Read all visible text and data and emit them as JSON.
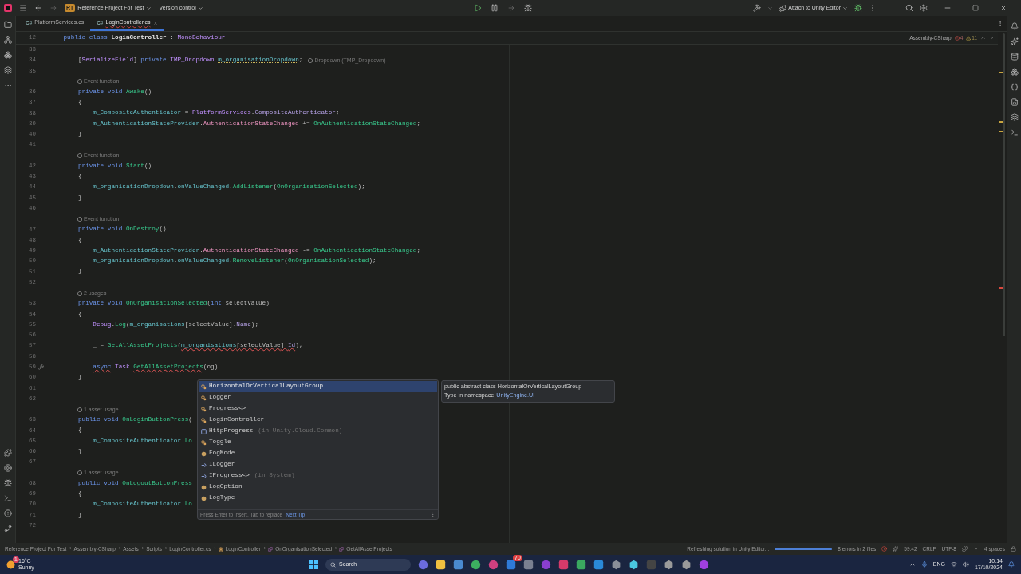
{
  "titlebar": {
    "project_badge": "RT",
    "project": "Reference Project For Test",
    "vcs": "Version control",
    "attach": "Attach to Unity Editor"
  },
  "tabs": [
    {
      "label": "PlatformServices.cs",
      "icon": "C#",
      "selected": false
    },
    {
      "label": "LoginController.cs",
      "icon": "C#",
      "selected": true
    }
  ],
  "editor": {
    "context": "Assembly-CSharp",
    "errors": "4",
    "warnings": "11",
    "sticky": {
      "n": "12",
      "tokens": [
        {
          "t": "    public class ",
          "kind": "kw"
        },
        {
          "t": "LoginController",
          "kind": "decl"
        },
        {
          "t": " : ",
          "kind": "plain"
        },
        {
          "t": "MonoBehaviour",
          "kind": "type"
        }
      ]
    },
    "rows": [
      {
        "kind": "code",
        "n": "33",
        "tokens": []
      },
      {
        "kind": "code",
        "n": "34",
        "tokens": [
          {
            "t": "        [",
            "kind": "plain"
          },
          {
            "t": "SerializeField",
            "kind": "type"
          },
          {
            "t": "] ",
            "kind": "plain"
          },
          {
            "t": "private ",
            "kind": "kw"
          },
          {
            "t": "TMP_Dropdown ",
            "kind": "type"
          },
          {
            "t": "m_organisationDropdown",
            "kind": "field_marked"
          },
          {
            "t": ";",
            "kind": "plain"
          }
        ],
        "inlay": "Dropdown (TMP_Dropdown)"
      },
      {
        "kind": "code",
        "n": "35",
        "tokens": []
      },
      {
        "kind": "hint",
        "text": "Event function"
      },
      {
        "kind": "code",
        "n": "36",
        "tokens": [
          {
            "t": "        private void ",
            "kind": "kw"
          },
          {
            "t": "Awake",
            "kind": "method"
          },
          {
            "t": "()",
            "kind": "plain"
          }
        ]
      },
      {
        "kind": "code",
        "n": "37",
        "tokens": [
          {
            "t": "        {",
            "kind": "plain"
          }
        ]
      },
      {
        "kind": "code",
        "n": "38",
        "tokens": [
          {
            "t": "            m_CompositeAuthenticator",
            "kind": "field"
          },
          {
            "t": " = ",
            "kind": "plain"
          },
          {
            "t": "PlatformServices",
            "kind": "type"
          },
          {
            "t": ".",
            "kind": "plain"
          },
          {
            "t": "CompositeAuthenticator",
            "kind": "prop"
          },
          {
            "t": ";",
            "kind": "plain"
          }
        ]
      },
      {
        "kind": "code",
        "n": "39",
        "tokens": [
          {
            "t": "            m_AuthenticationStateProvider",
            "kind": "field"
          },
          {
            "t": ".",
            "kind": "plain"
          },
          {
            "t": "AuthenticationStateChanged",
            "kind": "event"
          },
          {
            "t": " += ",
            "kind": "plain"
          },
          {
            "t": "OnAuthenticationStateChanged",
            "kind": "method"
          },
          {
            "t": ";",
            "kind": "plain"
          }
        ]
      },
      {
        "kind": "code",
        "n": "40",
        "tokens": [
          {
            "t": "        }",
            "kind": "plain"
          }
        ]
      },
      {
        "kind": "code",
        "n": "41",
        "tokens": []
      },
      {
        "kind": "hint",
        "text": "Event function"
      },
      {
        "kind": "code",
        "n": "42",
        "tokens": [
          {
            "t": "        private void ",
            "kind": "kw"
          },
          {
            "t": "Start",
            "kind": "method"
          },
          {
            "t": "()",
            "kind": "plain"
          }
        ]
      },
      {
        "kind": "code",
        "n": "43",
        "tokens": [
          {
            "t": "        {",
            "kind": "plain"
          }
        ]
      },
      {
        "kind": "code",
        "n": "44",
        "tokens": [
          {
            "t": "            m_organisationDropdown",
            "kind": "field"
          },
          {
            "t": ".",
            "kind": "plain"
          },
          {
            "t": "onValueChanged",
            "kind": "field"
          },
          {
            "t": ".",
            "kind": "plain"
          },
          {
            "t": "AddListener",
            "kind": "method"
          },
          {
            "t": "(",
            "kind": "plain"
          },
          {
            "t": "OnOrganisationSelected",
            "kind": "method"
          },
          {
            "t": ");",
            "kind": "plain"
          }
        ]
      },
      {
        "kind": "code",
        "n": "45",
        "tokens": [
          {
            "t": "        }",
            "kind": "plain"
          }
        ]
      },
      {
        "kind": "code",
        "n": "46",
        "tokens": []
      },
      {
        "kind": "hint",
        "text": "Event function"
      },
      {
        "kind": "code",
        "n": "47",
        "tokens": [
          {
            "t": "        private void ",
            "kind": "kw"
          },
          {
            "t": "OnDestroy",
            "kind": "method"
          },
          {
            "t": "()",
            "kind": "plain"
          }
        ]
      },
      {
        "kind": "code",
        "n": "48",
        "tokens": [
          {
            "t": "        {",
            "kind": "plain"
          }
        ]
      },
      {
        "kind": "code",
        "n": "49",
        "tokens": [
          {
            "t": "            m_AuthenticationStateProvider",
            "kind": "field"
          },
          {
            "t": ".",
            "kind": "plain"
          },
          {
            "t": "AuthenticationStateChanged",
            "kind": "event"
          },
          {
            "t": " -= ",
            "kind": "plain"
          },
          {
            "t": "OnAuthenticationStateChanged",
            "kind": "method"
          },
          {
            "t": ";",
            "kind": "plain"
          }
        ]
      },
      {
        "kind": "code",
        "n": "50",
        "tokens": [
          {
            "t": "            m_organisationDropdown",
            "kind": "field"
          },
          {
            "t": ".",
            "kind": "plain"
          },
          {
            "t": "onValueChanged",
            "kind": "field"
          },
          {
            "t": ".",
            "kind": "plain"
          },
          {
            "t": "RemoveListener",
            "kind": "method"
          },
          {
            "t": "(",
            "kind": "plain"
          },
          {
            "t": "OnOrganisationSelected",
            "kind": "method"
          },
          {
            "t": ");",
            "kind": "plain"
          }
        ]
      },
      {
        "kind": "code",
        "n": "51",
        "tokens": [
          {
            "t": "        }",
            "kind": "plain"
          }
        ]
      },
      {
        "kind": "code",
        "n": "52",
        "tokens": []
      },
      {
        "kind": "hint",
        "text": "2 usages"
      },
      {
        "kind": "code",
        "n": "53",
        "tokens": [
          {
            "t": "        private void ",
            "kind": "kw"
          },
          {
            "t": "OnOrganisationSelected",
            "kind": "method"
          },
          {
            "t": "(",
            "kind": "plain"
          },
          {
            "t": "int ",
            "kind": "kw"
          },
          {
            "t": "selectValue",
            "kind": "param"
          },
          {
            "t": ")",
            "kind": "plain"
          }
        ]
      },
      {
        "kind": "code",
        "n": "54",
        "tokens": [
          {
            "t": "        {",
            "kind": "plain"
          }
        ]
      },
      {
        "kind": "code",
        "n": "55",
        "tokens": [
          {
            "t": "            Debug",
            "kind": "type"
          },
          {
            "t": ".",
            "kind": "plain"
          },
          {
            "t": "Log",
            "kind": "method"
          },
          {
            "t": "(",
            "kind": "plain"
          },
          {
            "t": "m_organisations",
            "kind": "field"
          },
          {
            "t": "[",
            "kind": "plain"
          },
          {
            "t": "selectValue",
            "kind": "param"
          },
          {
            "t": "].",
            "kind": "plain"
          },
          {
            "t": "Name",
            "kind": "prop"
          },
          {
            "t": ");",
            "kind": "plain"
          }
        ]
      },
      {
        "kind": "code",
        "n": "56",
        "tokens": []
      },
      {
        "kind": "code",
        "n": "57",
        "tokens": [
          {
            "t": "            _ = ",
            "kind": "plain"
          },
          {
            "t": "GetAllAssetProjects",
            "kind": "method"
          },
          {
            "t": "(",
            "kind": "plain"
          },
          {
            "t": "m_organisations",
            "kind": "field_err"
          },
          {
            "t": "[",
            "kind": "plain_err"
          },
          {
            "t": "selectValue",
            "kind": "param_err"
          },
          {
            "t": "].",
            "kind": "plain_err"
          },
          {
            "t": "Id",
            "kind": "prop_err"
          },
          {
            "t": ");",
            "kind": "plain"
          }
        ]
      },
      {
        "kind": "code",
        "n": "58",
        "tokens": []
      },
      {
        "kind": "code_action",
        "n": "59",
        "tokens": [
          {
            "t": "            async",
            "kind": "kw_err"
          },
          {
            "t": " Task ",
            "kind": "type"
          },
          {
            "t": "GetAllAssetProjects",
            "kind": "method_err"
          },
          {
            "t": "(og)",
            "kind": "plain"
          }
        ]
      },
      {
        "kind": "code",
        "n": "60",
        "tokens": [
          {
            "t": "        }",
            "kind": "plain"
          }
        ]
      },
      {
        "kind": "code",
        "n": "61",
        "tokens": []
      },
      {
        "kind": "code",
        "n": "62",
        "tokens": []
      },
      {
        "kind": "hint",
        "text": "1 asset usage"
      },
      {
        "kind": "code",
        "n": "63",
        "tokens": [
          {
            "t": "        public void ",
            "kind": "kw"
          },
          {
            "t": "OnLoginButtonPress",
            "kind": "method"
          },
          {
            "t": "(",
            "kind": "plain"
          }
        ]
      },
      {
        "kind": "code",
        "n": "64",
        "tokens": [
          {
            "t": "        {",
            "kind": "plain"
          }
        ]
      },
      {
        "kind": "code",
        "n": "65",
        "tokens": [
          {
            "t": "            m_CompositeAuthenticator",
            "kind": "field"
          },
          {
            "t": ".",
            "kind": "plain"
          },
          {
            "t": "Lo",
            "kind": "method"
          }
        ]
      },
      {
        "kind": "code",
        "n": "66",
        "tokens": [
          {
            "t": "        }",
            "kind": "plain"
          }
        ]
      },
      {
        "kind": "code",
        "n": "67",
        "tokens": []
      },
      {
        "kind": "hint",
        "text": "1 asset usage"
      },
      {
        "kind": "code",
        "n": "68",
        "tokens": [
          {
            "t": "        public void ",
            "kind": "kw"
          },
          {
            "t": "OnLogoutButtonPress",
            "kind": "method"
          }
        ]
      },
      {
        "kind": "code",
        "n": "69",
        "tokens": [
          {
            "t": "        {",
            "kind": "plain"
          }
        ]
      },
      {
        "kind": "code",
        "n": "70",
        "tokens": [
          {
            "t": "            m_CompositeAuthenticator",
            "kind": "field"
          },
          {
            "t": ".",
            "kind": "plain"
          },
          {
            "t": "Lo",
            "kind": "method"
          }
        ]
      },
      {
        "kind": "code",
        "n": "71",
        "tokens": [
          {
            "t": "        }",
            "kind": "plain"
          }
        ]
      },
      {
        "kind": "code",
        "n": "72",
        "tokens": []
      }
    ]
  },
  "completion": {
    "items": [
      {
        "label": "HorizontalOrVerticalLayoutGroup",
        "kind": "class",
        "selected": true
      },
      {
        "label": "Logger",
        "kind": "class",
        "selected": false
      },
      {
        "label": "Progress<>",
        "kind": "class",
        "selected": false
      },
      {
        "label": "LoginController",
        "kind": "class",
        "selected": false
      },
      {
        "label": "HttpProgress",
        "kind": "struct",
        "note": "(in Unity.Cloud.Common)",
        "selected": false
      },
      {
        "label": "Toggle",
        "kind": "class",
        "selected": false
      },
      {
        "label": "FogMode",
        "kind": "enum",
        "selected": false
      },
      {
        "label": "ILogger",
        "kind": "interface",
        "selected": false
      },
      {
        "label": "IProgress<>",
        "kind": "interface",
        "note": "(in System)",
        "selected": false
      },
      {
        "label": "LogOption",
        "kind": "enum",
        "selected": false
      },
      {
        "label": "LogType",
        "kind": "enum",
        "selected": false
      }
    ],
    "footer": "Press Enter to insert, Tab to replace",
    "tip": "Next Tip",
    "doc": {
      "signature": "public abstract class HorizontalOrVerticalLayoutGroup",
      "namespace_label": "Type in namespace",
      "namespace": "UnityEngine.UI"
    }
  },
  "statusbar": {
    "separator": "›",
    "breadcrumbs": [
      {
        "label": "Reference Project For Test",
        "kind": "text"
      },
      {
        "label": "Assembly-CSharp",
        "kind": "text"
      },
      {
        "label": "Assets",
        "kind": "text"
      },
      {
        "label": "Scripts",
        "kind": "text"
      },
      {
        "label": "LoginController.cs",
        "kind": "text"
      },
      {
        "label": "LoginController",
        "kind": "class"
      },
      {
        "label": "OnOrganisationSelected",
        "kind": "method"
      },
      {
        "label": "GetAllAssetProjects",
        "kind": "method"
      }
    ],
    "task": "Refreshing solution in Unity Editor...",
    "level": 1,
    "problems": "8 errors in 2 files",
    "position": "59:42",
    "line_ending": "CRLF",
    "encoding": "UTF-8",
    "indent": "4 spaces"
  },
  "taskbar": {
    "temperature": "16°C",
    "weather": "Sunny",
    "weather_badge": "1",
    "search": "Search",
    "app_badge": "70",
    "language": "ENG",
    "time": "10:14",
    "date": "17/10/2024"
  }
}
